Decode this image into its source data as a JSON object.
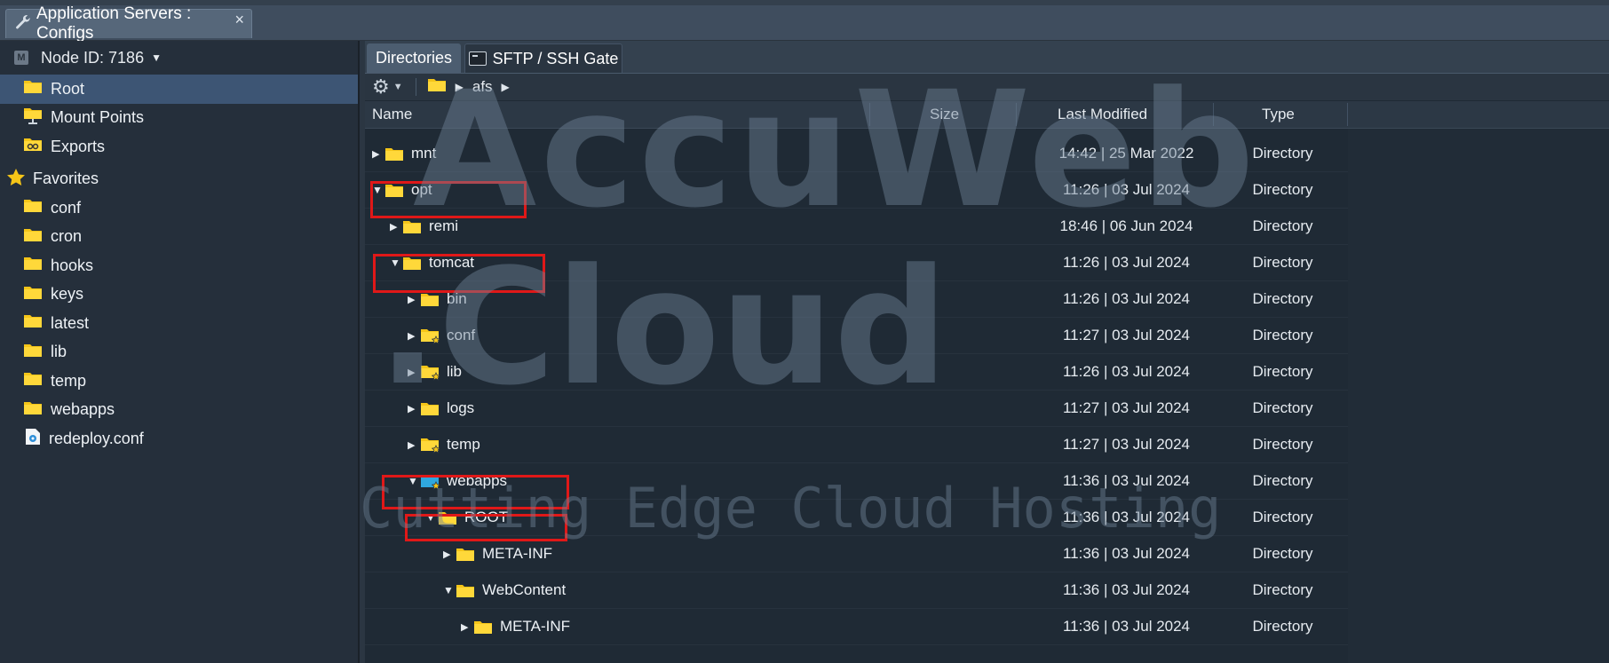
{
  "window": {
    "tab_title": "Application Servers : Configs",
    "close_glyph": "×"
  },
  "sidebar": {
    "node_badge": "M",
    "node_label": "Node ID: 7186",
    "items": [
      {
        "label": "Root",
        "icon": "folder-icon"
      },
      {
        "label": "Mount Points",
        "icon": "mount-folder-icon"
      },
      {
        "label": "Exports",
        "icon": "export-folder-icon"
      }
    ],
    "favorites_label": "Favorites",
    "favorites": [
      "conf",
      "cron",
      "hooks",
      "keys",
      "latest",
      "lib",
      "temp",
      "webapps",
      "redeploy.conf"
    ]
  },
  "tabs": {
    "directories": "Directories",
    "sftp": "SFTP / SSH Gate"
  },
  "breadcrumb": {
    "path": "afs"
  },
  "grid": {
    "headers": {
      "name": "Name",
      "size": "Size",
      "modified": "Last Modified",
      "type": "Type"
    },
    "rows": [
      {
        "name": "mnt",
        "modified": "14:42 | 25 Mar 2022",
        "type": "Directory"
      },
      {
        "name": "opt",
        "modified": "11:26 | 03 Jul 2024",
        "type": "Directory"
      },
      {
        "name": "remi",
        "modified": "18:46 | 06 Jun 2024",
        "type": "Directory"
      },
      {
        "name": "tomcat",
        "modified": "11:26 | 03 Jul 2024",
        "type": "Directory"
      },
      {
        "name": "bin",
        "modified": "11:26 | 03 Jul 2024",
        "type": "Directory"
      },
      {
        "name": "conf",
        "modified": "11:27 | 03 Jul 2024",
        "type": "Directory"
      },
      {
        "name": "lib",
        "modified": "11:26 | 03 Jul 2024",
        "type": "Directory"
      },
      {
        "name": "logs",
        "modified": "11:27 | 03 Jul 2024",
        "type": "Directory"
      },
      {
        "name": "temp",
        "modified": "11:27 | 03 Jul 2024",
        "type": "Directory"
      },
      {
        "name": "webapps",
        "modified": "11:36 | 03 Jul 2024",
        "type": "Directory"
      },
      {
        "name": "ROOT",
        "modified": "11:36 | 03 Jul 2024",
        "type": "Directory"
      },
      {
        "name": "META-INF",
        "modified": "11:36 | 03 Jul 2024",
        "type": "Directory"
      },
      {
        "name": "WebContent",
        "modified": "11:36 | 03 Jul 2024",
        "type": "Directory"
      },
      {
        "name": "META-INF",
        "modified": "11:36 | 03 Jul 2024",
        "type": "Directory"
      }
    ]
  },
  "watermark": {
    "line1": "AccuWeb",
    "line2": ".Cloud",
    "line3": "Cutting Edge Cloud Hosting"
  },
  "colors": {
    "folder": "#f5c518",
    "selected": "#3d5574",
    "highlight": "#e01818",
    "webapps_folder": "#2fa8e0"
  }
}
